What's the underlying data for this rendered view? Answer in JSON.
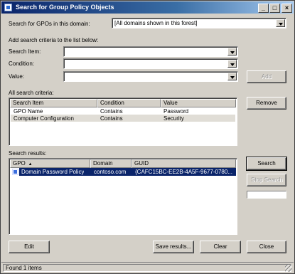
{
  "window": {
    "title": "Search for Group Policy Objects",
    "controls": {
      "minimize": "_",
      "maximize": "□",
      "close": "×"
    }
  },
  "domain_row": {
    "label": "Search for GPOs in this domain:",
    "value": "[All domains shown in this forest]"
  },
  "criteria": {
    "heading": "Add search criteria to the list below:",
    "search_item_label": "Search Item:",
    "condition_label": "Condition:",
    "value_label": "Value:",
    "search_item_value": "",
    "condition_value": "",
    "value_value": "",
    "add_button": "Add"
  },
  "all_criteria": {
    "label": "All search criteria:",
    "columns": [
      "Search Item",
      "Condition",
      "Value"
    ],
    "rows": [
      [
        "GPO Name",
        "Contains",
        "Password"
      ],
      [
        "Computer Configuration",
        "Contains",
        "Security"
      ]
    ],
    "remove_button": "Remove"
  },
  "results": {
    "label": "Search results:",
    "columns": [
      "GPO",
      "Domain",
      "GUID"
    ],
    "rows": [
      [
        "Domain Password Policy",
        "contoso.com",
        "{CAFC15BC-EE2B-4A5F-9677-0780..."
      ]
    ],
    "search_button": "Search",
    "stop_button": "Stop Search"
  },
  "footer_buttons": {
    "edit": "Edit",
    "save": "Save results...",
    "clear": "Clear",
    "close": "Close"
  },
  "status": {
    "text": "Found 1 items"
  },
  "icons": {
    "app": "gpo-search-icon",
    "row": "gpo-icon",
    "sort": "sort-ascending-icon"
  },
  "colors": {
    "titlebar_start": "#0a246a",
    "titlebar_end": "#a6caf0",
    "face": "#d4d0c8",
    "selection": "#0a246a"
  }
}
